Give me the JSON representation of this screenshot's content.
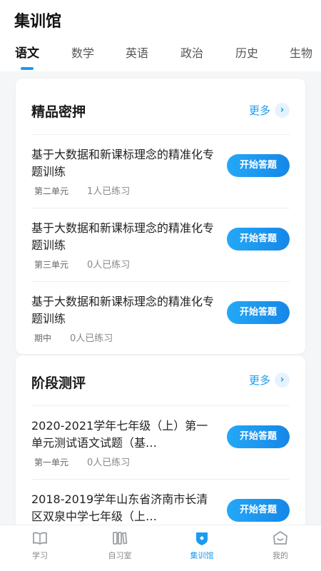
{
  "header": {
    "title": "集训馆"
  },
  "tabs": [
    {
      "label": "语文",
      "active": true
    },
    {
      "label": "数学"
    },
    {
      "label": "英语"
    },
    {
      "label": "政治"
    },
    {
      "label": "历史"
    },
    {
      "label": "生物"
    }
  ],
  "sections": [
    {
      "title": "精品密押",
      "more": "更多",
      "items": [
        {
          "title": "基于大数据和新课标理念的精准化专题训练",
          "unit": "第二单元",
          "count": "1人已练习",
          "button": "开始答题"
        },
        {
          "title": "基于大数据和新课标理念的精准化专题训练",
          "unit": "第三单元",
          "count": "0人已练习",
          "button": "开始答题"
        },
        {
          "title": "基于大数据和新课标理念的精准化专题训练",
          "unit": "期中",
          "count": "0人已练习",
          "button": "开始答题"
        }
      ]
    },
    {
      "title": "阶段测评",
      "more": "更多",
      "items": [
        {
          "title": "2020-2021学年七年级（上）第一单元测试语文试题（基…",
          "unit": "第一单元",
          "count": "0人已练习",
          "button": "开始答题"
        },
        {
          "title": "2018-2019学年山东省济南市长清区双泉中学七年级（上…",
          "unit": "",
          "count": "",
          "button": "开始答题"
        }
      ]
    }
  ],
  "bottom_nav": [
    {
      "label": "学习",
      "icon": "book-icon"
    },
    {
      "label": "自习室",
      "icon": "bookshelf-icon"
    },
    {
      "label": "集训馆",
      "icon": "training-shield-icon",
      "active": true
    },
    {
      "label": "我的",
      "icon": "profile-icon"
    }
  ],
  "colors": {
    "accent": "#1a9cf0",
    "background": "#f5f6f8"
  }
}
